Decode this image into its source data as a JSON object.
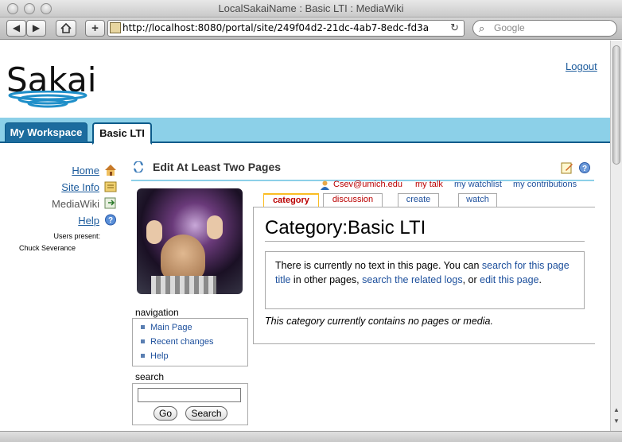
{
  "window": {
    "title": "LocalSakaiName : Basic LTI : MediaWiki",
    "url": "http://localhost:8080/portal/site/249f04d2-21dc-4ab7-8edc-fd3a",
    "search_placeholder": "Google"
  },
  "header": {
    "logo_text": "Sakai",
    "logout_label": "Logout"
  },
  "site_tabs": [
    {
      "label": "My Workspace"
    },
    {
      "label": "Basic LTI"
    }
  ],
  "left_nav": {
    "items": [
      {
        "label": "Home",
        "icon": "home-icon"
      },
      {
        "label": "Site Info",
        "icon": "site-info-icon"
      },
      {
        "label": "MediaWiki",
        "icon": "mediawiki-icon"
      },
      {
        "label": "Help",
        "icon": "help-icon"
      }
    ],
    "users_present_label": "Users present:",
    "users": [
      "Chuck Severance"
    ]
  },
  "tool": {
    "title": "Edit At Least Two Pages"
  },
  "wiki": {
    "personal_links": [
      "Csev@umich.edu",
      "my talk",
      "my watchlist",
      "my contributions"
    ],
    "tabs": [
      {
        "label": "category"
      },
      {
        "label": "discussion"
      },
      {
        "label": "create"
      },
      {
        "label": "watch"
      }
    ],
    "page_title": "Category:Basic LTI",
    "notice": {
      "text_1": "There is currently no text in this page. You can ",
      "link_1": "search for this page title",
      "text_2": " in other pages, ",
      "link_2": "search the related logs",
      "text_3": ", or ",
      "link_3": "edit this page",
      "text_4": "."
    },
    "empty_note": "This category currently contains no pages or media.",
    "navigation": {
      "title": "navigation",
      "items": [
        "Main Page",
        "Recent changes",
        "Help"
      ]
    },
    "search": {
      "title": "search",
      "go_label": "Go",
      "search_label": "Search",
      "value": ""
    }
  },
  "colors": {
    "accent": "#8cd0e8",
    "tab_active_border": "#0c5b8a",
    "link": "#1c4f9c",
    "wiki_red_link": "#ba0000"
  }
}
